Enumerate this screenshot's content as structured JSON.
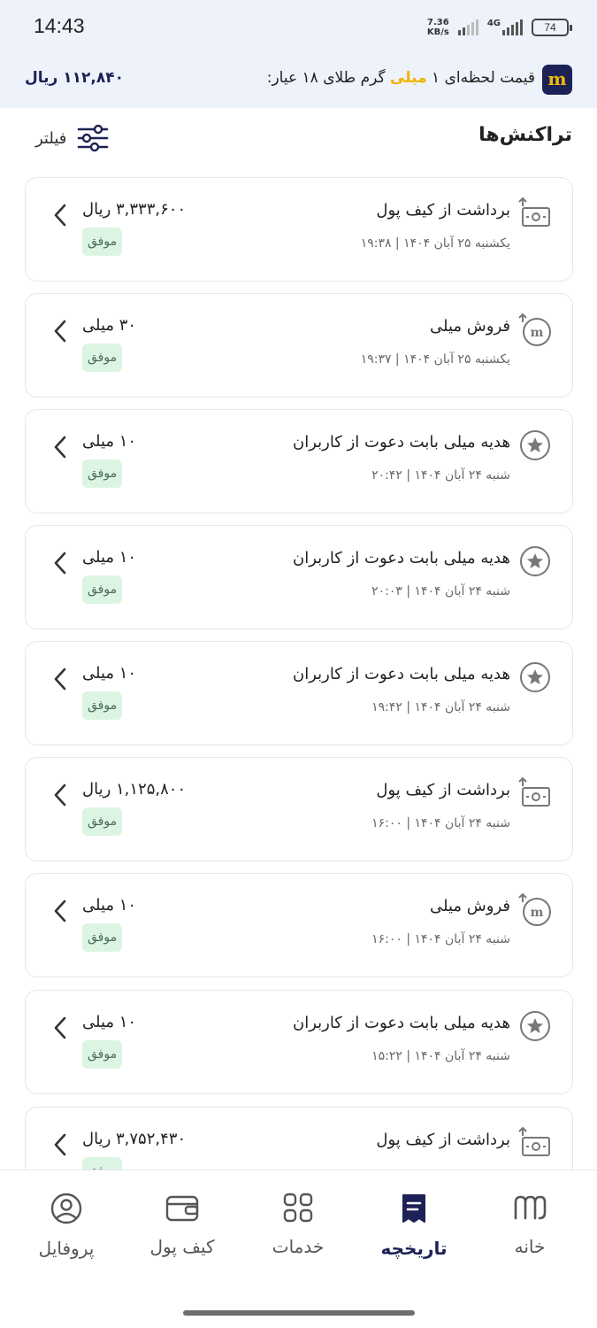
{
  "status_bar": {
    "time": "14:43",
    "net_speed_value": "7.36",
    "net_speed_unit": "KB/s",
    "network": "4G",
    "battery": "74"
  },
  "price_bar": {
    "text_before": "قیمت لحظه‌ای ۱ ",
    "text_highlight": "میلی",
    "text_after": " گرم طلای ۱۸ عیار:",
    "value": "۱۱۲,۸۴۰ ریال",
    "logo_letter": "m"
  },
  "page": {
    "title": "تراکنش‌ها",
    "filter_label": "فیلتر"
  },
  "transactions": [
    {
      "icon": "withdraw-icon",
      "title": "برداشت از کیف پول",
      "date": "یکشنبه ۲۵ آبان ۱۴۰۴ | ۱۹:۳۸",
      "amount": "۳,۳۳۳,۶۰۰ ریال",
      "status": "موفق"
    },
    {
      "icon": "milli-sell-icon",
      "title": "فروش میلی",
      "date": "یکشنبه ۲۵ آبان ۱۴۰۴ | ۱۹:۳۷",
      "amount": "۳۰ میلی",
      "status": "موفق"
    },
    {
      "icon": "star-icon",
      "title": "هدیه میلی بابت دعوت از کاربران",
      "date": "شنبه ۲۴ آبان ۱۴۰۴ | ۲۰:۴۲",
      "amount": "۱۰ میلی",
      "status": "موفق"
    },
    {
      "icon": "star-icon",
      "title": "هدیه میلی بابت دعوت از کاربران",
      "date": "شنبه ۲۴ آبان ۱۴۰۴ | ۲۰:۰۳",
      "amount": "۱۰ میلی",
      "status": "موفق"
    },
    {
      "icon": "star-icon",
      "title": "هدیه میلی بابت دعوت از کاربران",
      "date": "شنبه ۲۴ آبان ۱۴۰۴ | ۱۹:۴۲",
      "amount": "۱۰ میلی",
      "status": "موفق"
    },
    {
      "icon": "withdraw-icon",
      "title": "برداشت از کیف پول",
      "date": "شنبه ۲۴ آبان ۱۴۰۴ | ۱۶:۰۰",
      "amount": "۱,۱۲۵,۸۰۰ ریال",
      "status": "موفق"
    },
    {
      "icon": "milli-sell-icon",
      "title": "فروش میلی",
      "date": "شنبه ۲۴ آبان ۱۴۰۴ | ۱۶:۰۰",
      "amount": "۱۰ میلی",
      "status": "موفق"
    },
    {
      "icon": "star-icon",
      "title": "هدیه میلی بابت دعوت از کاربران",
      "date": "شنبه ۲۴ آبان ۱۴۰۴ | ۱۵:۲۲",
      "amount": "۱۰ میلی",
      "status": "موفق"
    },
    {
      "icon": "withdraw-icon",
      "title": "برداشت از کیف پول",
      "date": "",
      "amount": "۳,۷۵۲,۴۳۰ ریال",
      "status": "موفق"
    }
  ],
  "bottom_nav": [
    {
      "label": "خانه",
      "icon": "home-logo-icon",
      "active": false
    },
    {
      "label": "تاریخچه",
      "icon": "history-icon",
      "active": true
    },
    {
      "label": "خدمات",
      "icon": "services-grid-icon",
      "active": false
    },
    {
      "label": "کیف پول",
      "icon": "wallet-icon",
      "active": false
    },
    {
      "label": "پروفایل",
      "icon": "profile-icon",
      "active": false
    }
  ],
  "colors": {
    "brand_navy": "#1c2255",
    "brand_gold": "#f0b400",
    "success_bg": "#dcf5e3",
    "header_bg": "#eef2fb"
  }
}
